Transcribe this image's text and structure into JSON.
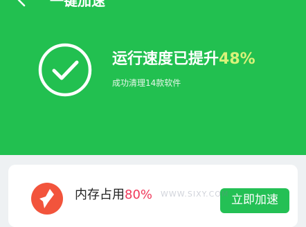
{
  "header": {
    "title": "一键加速",
    "back_icon": "back-arrow-icon",
    "background_color": "#22c050"
  },
  "result": {
    "icon": "check-circle-icon",
    "headline_prefix": "运行速度已提升",
    "headline_percent": "48%",
    "subline": "成功清理14款软件",
    "percent_color": "#d9f27a"
  },
  "memory_card": {
    "icon": "rocket-icon",
    "label": "内存占用",
    "percent": "80%",
    "percent_color": "#f0385a",
    "button_label": "立即加速",
    "watermark": "WWW.SIXY.COM"
  }
}
